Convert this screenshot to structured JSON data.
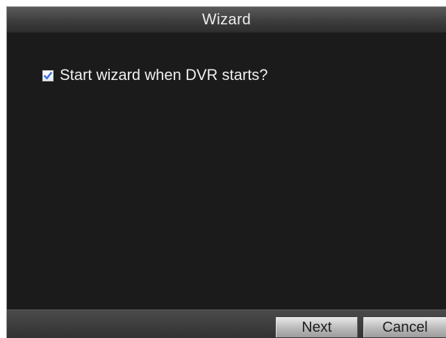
{
  "dialog": {
    "title": "Wizard",
    "option": {
      "label": "Start wizard when DVR starts?",
      "checked": true
    },
    "buttons": {
      "next_label": "Next",
      "cancel_label": "Cancel"
    }
  },
  "colors": {
    "background": "#1b1b1b",
    "title_bar": "#3e3e3e",
    "checkmark": "#3a6fd8",
    "button": "#b8b8b8",
    "text": "#f0f0f0"
  },
  "icons": {
    "checkbox": "checkmark-icon"
  }
}
